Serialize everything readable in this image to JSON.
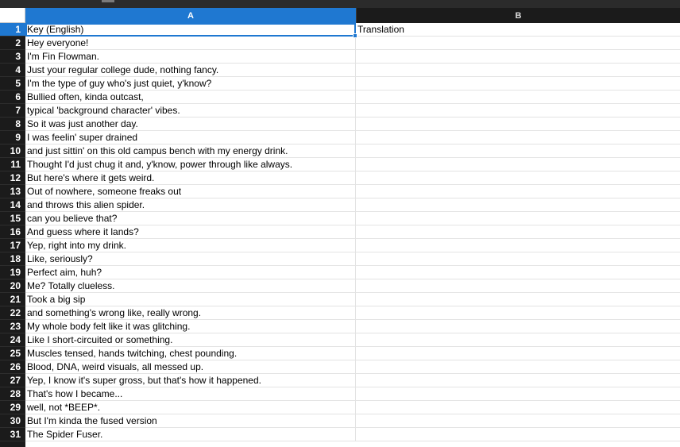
{
  "columns": [
    {
      "label": "A",
      "active": true
    },
    {
      "label": "B",
      "active": false
    }
  ],
  "rows": [
    {
      "num": "1",
      "a": "Key (English)",
      "b": "Translation"
    },
    {
      "num": "2",
      "a": "Hey everyone!",
      "b": ""
    },
    {
      "num": "3",
      "a": "I'm Fin Flowman.",
      "b": ""
    },
    {
      "num": "4",
      "a": "Just your regular college dude, nothing fancy.",
      "b": ""
    },
    {
      "num": "5",
      "a": "I'm the type of guy who's just quiet, y'know?",
      "b": ""
    },
    {
      "num": "6",
      "a": "Bullied often, kinda outcast,",
      "b": ""
    },
    {
      "num": "7",
      "a": "typical 'background character' vibes.",
      "b": ""
    },
    {
      "num": "8",
      "a": "So it was just another day.",
      "b": ""
    },
    {
      "num": "9",
      "a": "I was feelin' super drained",
      "b": ""
    },
    {
      "num": "10",
      "a": "and just sittin' on this old campus bench with my energy drink.",
      "b": ""
    },
    {
      "num": "11",
      "a": "Thought I'd just chug it and, y'know, power through like always.",
      "b": ""
    },
    {
      "num": "12",
      "a": "But here's where it gets weird.",
      "b": ""
    },
    {
      "num": "13",
      "a": "Out of nowhere, someone freaks out",
      "b": ""
    },
    {
      "num": "14",
      "a": "and throws this alien spider.",
      "b": ""
    },
    {
      "num": "15",
      "a": "can you believe that?",
      "b": ""
    },
    {
      "num": "16",
      "a": "And guess where it lands?",
      "b": ""
    },
    {
      "num": "17",
      "a": "Yep, right into my drink.",
      "b": ""
    },
    {
      "num": "18",
      "a": "Like, seriously?",
      "b": ""
    },
    {
      "num": "19",
      "a": "Perfect aim, huh?",
      "b": ""
    },
    {
      "num": "20",
      "a": "Me? Totally clueless.",
      "b": ""
    },
    {
      "num": "21",
      "a": "Took a big sip",
      "b": ""
    },
    {
      "num": "22",
      "a": "and something's wrong like, really wrong.",
      "b": ""
    },
    {
      "num": "23",
      "a": "My whole body felt like it was glitching.",
      "b": ""
    },
    {
      "num": "24",
      "a": "Like I short-circuited or something.",
      "b": ""
    },
    {
      "num": "25",
      "a": "Muscles tensed, hands twitching, chest pounding.",
      "b": ""
    },
    {
      "num": "26",
      "a": "Blood, DNA, weird visuals, all messed up.",
      "b": ""
    },
    {
      "num": "27",
      "a": "Yep, I know it's super gross, but that's how it happened.",
      "b": ""
    },
    {
      "num": "28",
      "a": "That's how I became...",
      "b": ""
    },
    {
      "num": "29",
      "a": "well, not *BEEP*.",
      "b": ""
    },
    {
      "num": "30",
      "a": "But I'm kinda the fused version",
      "b": ""
    },
    {
      "num": "31",
      "a": "The Spider Fuser.",
      "b": ""
    }
  ]
}
